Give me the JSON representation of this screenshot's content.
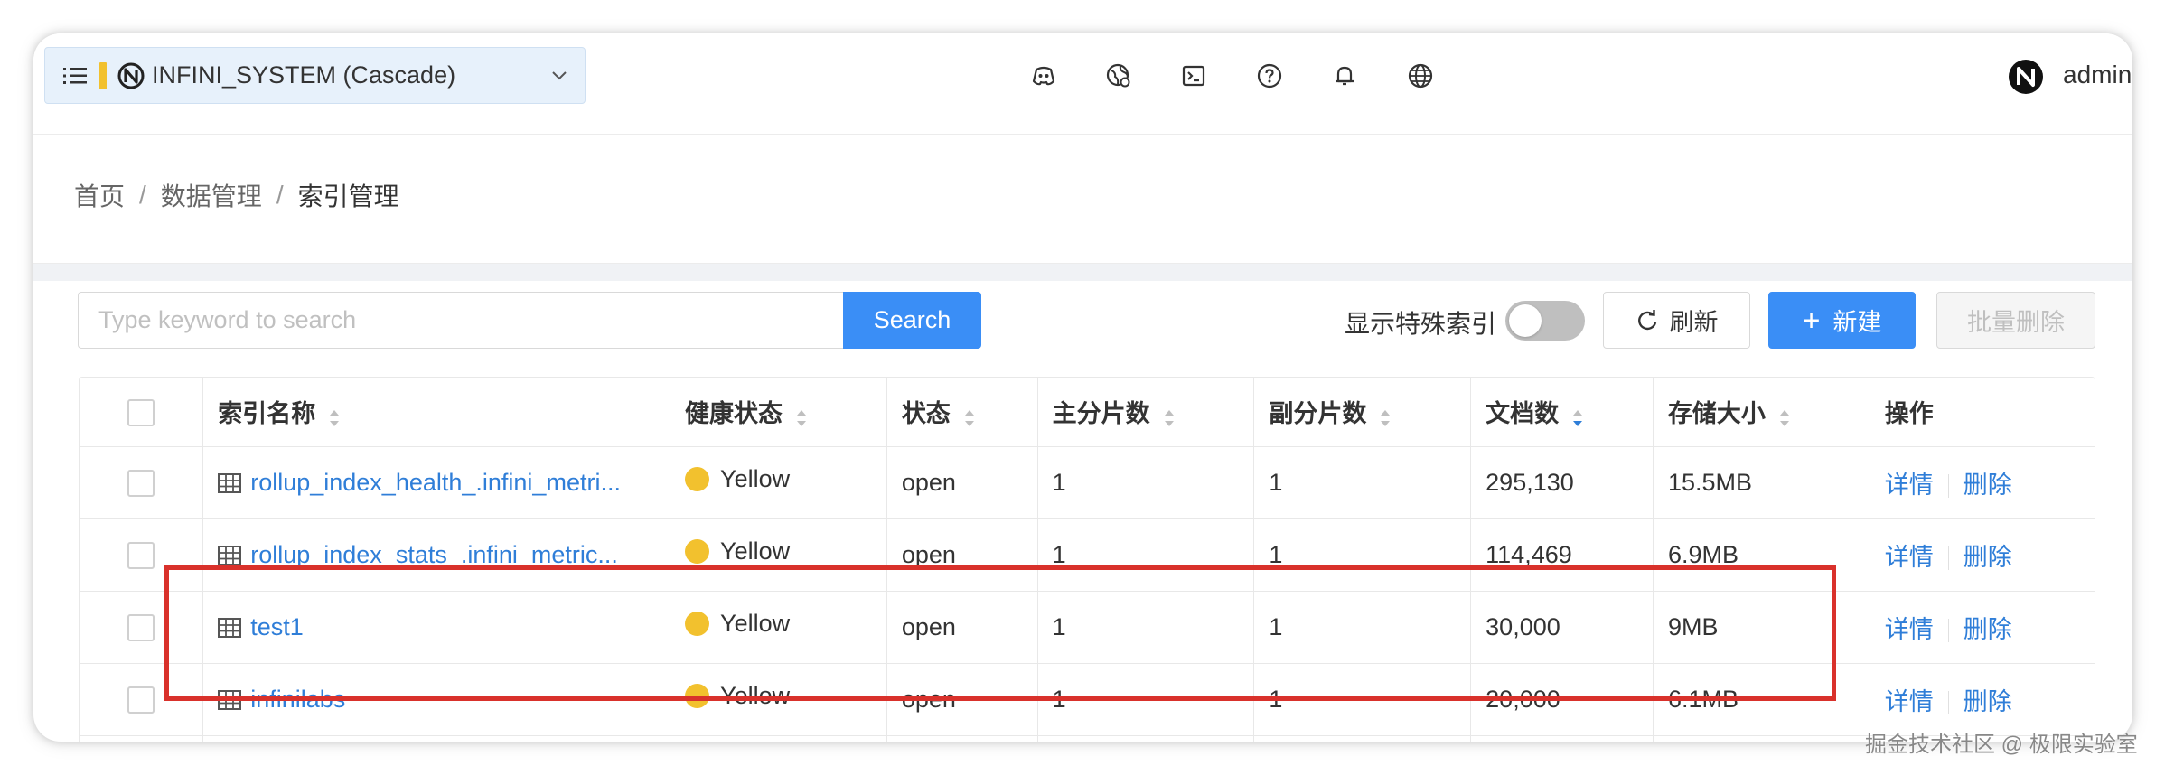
{
  "header": {
    "cluster_name": "INFINI_SYSTEM (Cascade)",
    "user_name": "admin",
    "icons": [
      "discord-icon",
      "monitor-globe-icon",
      "terminal-icon",
      "help-icon",
      "bell-icon",
      "globe-icon"
    ]
  },
  "breadcrumb": {
    "items": [
      "首页",
      "数据管理",
      "索引管理"
    ],
    "separator": "/"
  },
  "toolbar": {
    "search_placeholder": "Type keyword to search",
    "search_label": "Search",
    "special_index_label": "显示特殊索引",
    "special_index_enabled": false,
    "refresh_label": "刷新",
    "new_label": "新建",
    "batch_delete_label": "批量删除"
  },
  "table": {
    "columns": [
      "索引名称",
      "健康状态",
      "状态",
      "主分片数",
      "副分片数",
      "文档数",
      "存储大小",
      "操作"
    ],
    "sorted_column": "文档数",
    "sort_direction": "descending",
    "rows": [
      {
        "name": "rollup_index_health_.infini_metri...",
        "health": "Yellow",
        "status": "open",
        "primary": "1",
        "replica": "1",
        "docs": "295,130",
        "size": "15.5MB"
      },
      {
        "name": "rollup_index_stats_.infini_metric...",
        "health": "Yellow",
        "status": "open",
        "primary": "1",
        "replica": "1",
        "docs": "114,469",
        "size": "6.9MB"
      },
      {
        "name": "test1",
        "health": "Yellow",
        "status": "open",
        "primary": "1",
        "replica": "1",
        "docs": "30,000",
        "size": "9MB"
      },
      {
        "name": "infinilabs",
        "health": "Yellow",
        "status": "open",
        "primary": "1",
        "replica": "1",
        "docs": "20,000",
        "size": "6.1MB"
      }
    ],
    "actions": {
      "detail": "详情",
      "delete": "删除"
    }
  },
  "colors": {
    "primary": "#3a8ef6",
    "link": "#2f7ed8",
    "health_yellow": "#f2c12e",
    "highlight_red": "#d9312b"
  },
  "watermark": "掘金技术社区 @ 极限实验室"
}
